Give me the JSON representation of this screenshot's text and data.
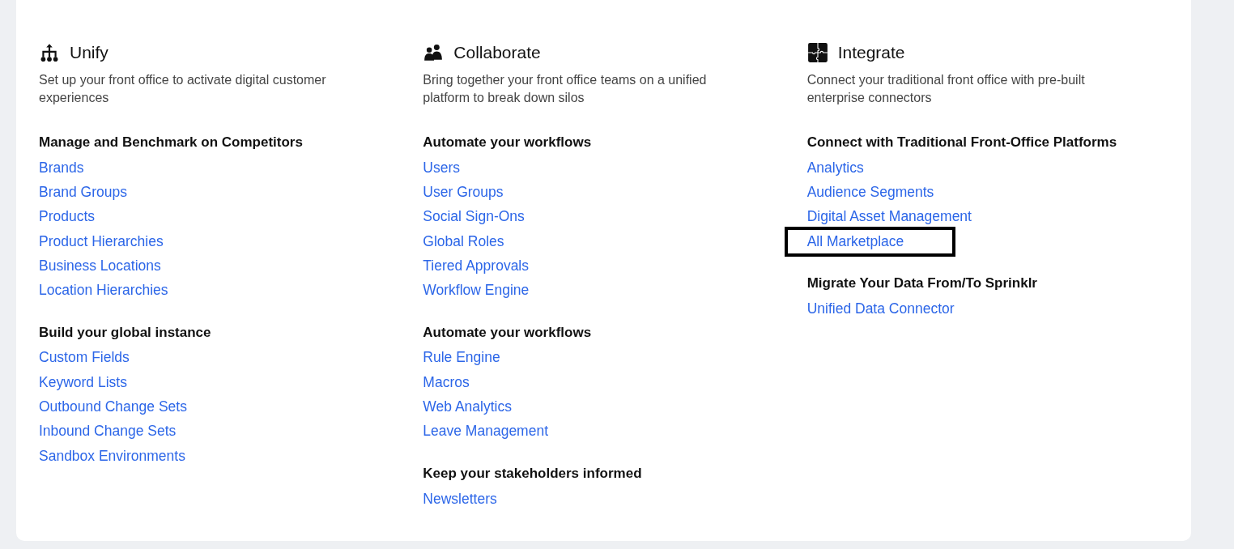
{
  "columns": [
    {
      "kind": "hierarchy",
      "title": "Unify",
      "description": "Set up your front office to activate digital customer experiences",
      "sections": [
        {
          "heading": "Manage and Benchmark on Competitors",
          "links": [
            {
              "label": "Brands",
              "highlighted": false
            },
            {
              "label": "Brand Groups",
              "highlighted": false
            },
            {
              "label": "Products",
              "highlighted": false
            },
            {
              "label": "Product Hierarchies",
              "highlighted": false
            },
            {
              "label": "Business Locations",
              "highlighted": false
            },
            {
              "label": "Location Hierarchies",
              "highlighted": false
            }
          ]
        },
        {
          "heading": "Build your global instance",
          "links": [
            {
              "label": "Custom Fields",
              "highlighted": false
            },
            {
              "label": "Keyword Lists",
              "highlighted": false
            },
            {
              "label": "Outbound Change Sets",
              "highlighted": false
            },
            {
              "label": "Inbound Change Sets",
              "highlighted": false
            },
            {
              "label": "Sandbox Environments",
              "highlighted": false
            }
          ]
        }
      ]
    },
    {
      "kind": "people",
      "title": "Collaborate",
      "description": "Bring together your front office teams on a unified platform to break down silos",
      "sections": [
        {
          "heading": "Automate your workflows",
          "links": [
            {
              "label": "Users",
              "highlighted": false
            },
            {
              "label": "User Groups",
              "highlighted": false
            },
            {
              "label": "Social Sign-Ons",
              "highlighted": false
            },
            {
              "label": "Global Roles",
              "highlighted": false
            },
            {
              "label": "Tiered Approvals",
              "highlighted": false
            },
            {
              "label": "Workflow Engine",
              "highlighted": false
            }
          ]
        },
        {
          "heading": "Automate your workflows",
          "links": [
            {
              "label": "Rule Engine",
              "highlighted": false
            },
            {
              "label": "Macros",
              "highlighted": false
            },
            {
              "label": "Web Analytics",
              "highlighted": false
            },
            {
              "label": "Leave Management",
              "highlighted": false
            }
          ]
        },
        {
          "heading": "Keep your stakeholders informed",
          "links": [
            {
              "label": "Newsletters",
              "highlighted": false
            }
          ]
        }
      ]
    },
    {
      "kind": "puzzle",
      "title": "Integrate",
      "description": "Connect your traditional front office with pre-built enterprise connectors",
      "sections": [
        {
          "heading": "Connect with Traditional Front-Office Platforms",
          "links": [
            {
              "label": "Analytics",
              "highlighted": false
            },
            {
              "label": "Audience Segments",
              "highlighted": false
            },
            {
              "label": "Digital Asset Management",
              "highlighted": false
            },
            {
              "label": "All Marketplace",
              "highlighted": true
            }
          ]
        },
        {
          "heading": "Migrate Your Data From/To Sprinklr",
          "links": [
            {
              "label": "Unified Data Connector",
              "highlighted": false
            }
          ]
        }
      ]
    }
  ]
}
